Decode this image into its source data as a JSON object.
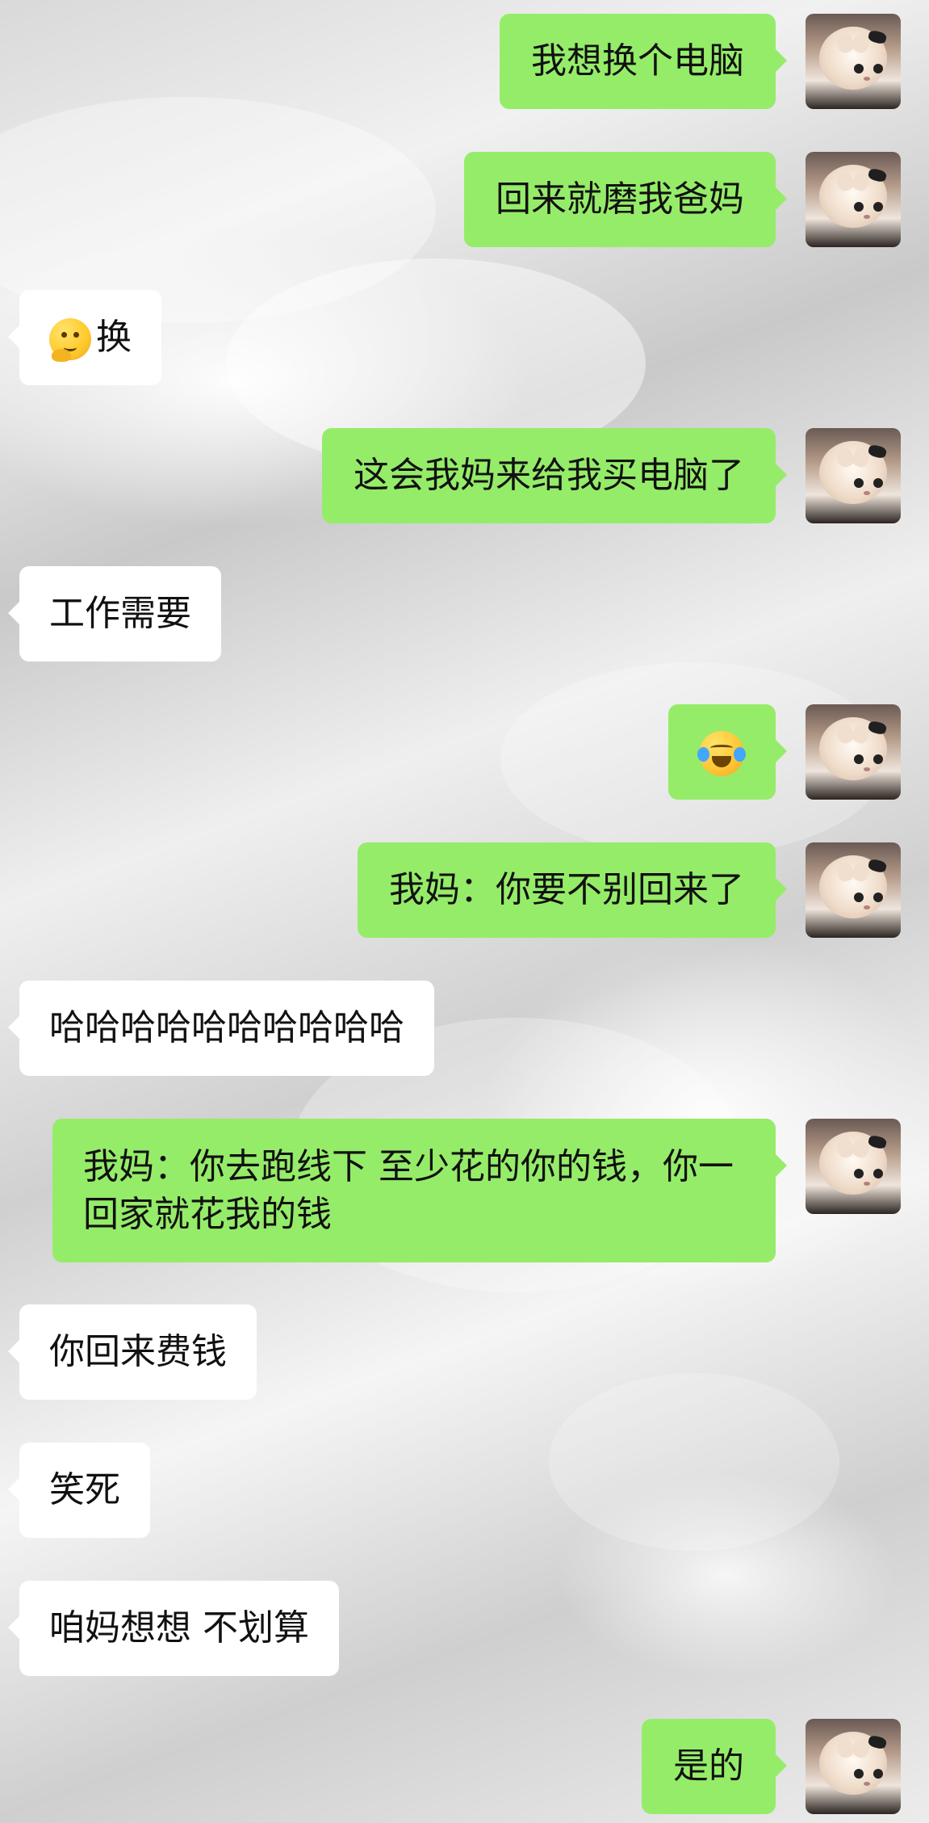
{
  "messages": [
    {
      "side": "right",
      "text": "我想换个电脑"
    },
    {
      "side": "right",
      "text": "回来就磨我爸妈"
    },
    {
      "side": "left",
      "text": "换",
      "emoji": "thinking-face-icon"
    },
    {
      "side": "right",
      "text": "这会我妈来给我买电脑了"
    },
    {
      "side": "left",
      "text": "工作需要"
    },
    {
      "side": "right",
      "text": "",
      "emoji": "loudly-crying-face-icon"
    },
    {
      "side": "right",
      "text": "我妈：你要不别回来了"
    },
    {
      "side": "left",
      "text": "哈哈哈哈哈哈哈哈哈哈"
    },
    {
      "side": "right",
      "text": "我妈：你去跑线下 至少花的你的钱，你一回家就花我的钱"
    },
    {
      "side": "left",
      "text": "你回来费钱"
    },
    {
      "side": "left",
      "text": "笑死"
    },
    {
      "side": "left",
      "text": "咱妈想想 不划算"
    },
    {
      "side": "right",
      "text": "是的"
    }
  ]
}
